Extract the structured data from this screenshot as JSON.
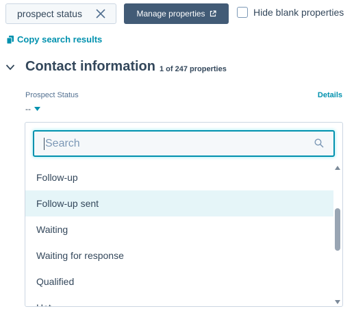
{
  "search_chip": {
    "text": "prospect status",
    "clear_icon": "close-icon"
  },
  "toolbar": {
    "manage_label": "Manage properties",
    "manage_icon": "external-link-icon",
    "hide_blank_label": "Hide blank properties",
    "hide_blank_checked": false
  },
  "copy_link": {
    "label": "Copy search results",
    "icon": "copy-icon"
  },
  "section": {
    "title": "Contact information",
    "count": "1 of 247 properties",
    "icon": "chevron-down-icon"
  },
  "property": {
    "label": "Prospect Status",
    "value": "--",
    "details_label": "Details"
  },
  "dropdown": {
    "search_placeholder": "Search",
    "search_icon": "search-icon",
    "options": [
      {
        "label": "Follow-up",
        "highlighted": false
      },
      {
        "label": "Follow-up sent",
        "highlighted": true
      },
      {
        "label": "Waiting",
        "highlighted": false
      },
      {
        "label": "Waiting for response",
        "highlighted": false
      },
      {
        "label": "Qualified",
        "highlighted": false
      },
      {
        "label": "Hot",
        "highlighted": false
      }
    ]
  },
  "colors": {
    "accent": "#0091ae",
    "button_bg": "#425b76",
    "text": "#33475b",
    "highlight": "#e5f5f8"
  }
}
